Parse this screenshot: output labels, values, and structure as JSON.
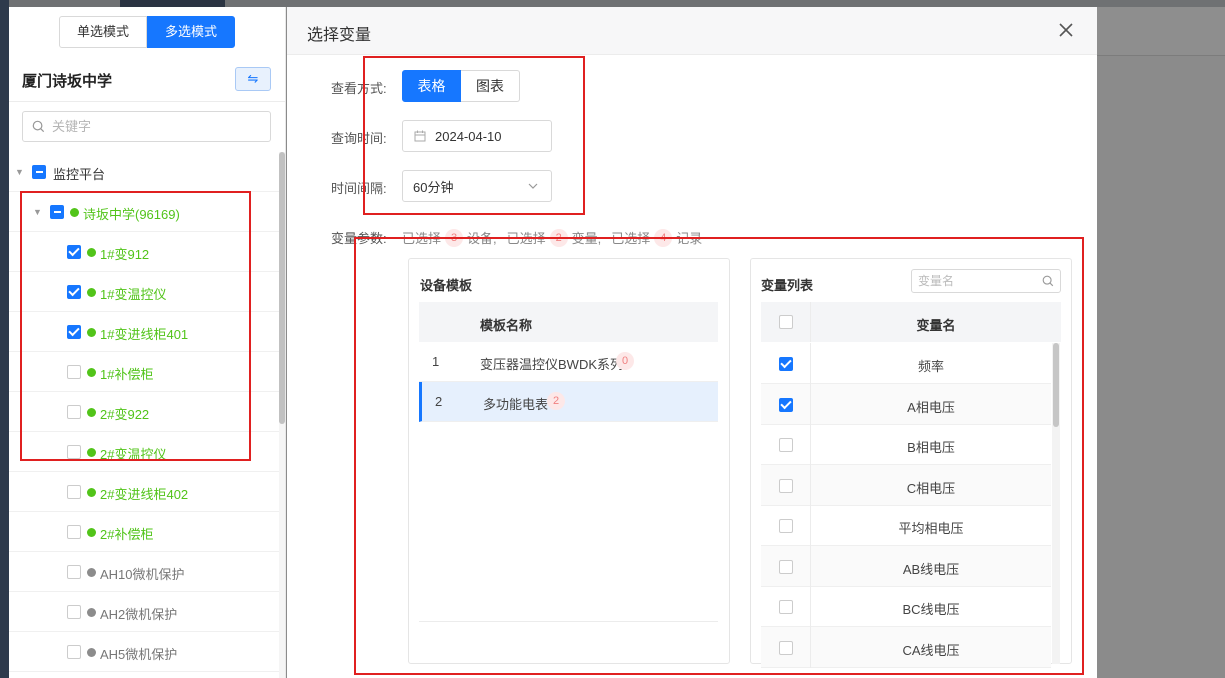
{
  "left_panel": {
    "mode_single": "单选模式",
    "mode_multi": "多选模式",
    "org_title": "厦门诗坂中学",
    "swap_symbol": "⇋",
    "search_placeholder": "关键字",
    "tree": [
      {
        "label": "监控平台",
        "state": "partial",
        "level": 0,
        "dot": "none",
        "color": "dark",
        "expanded": true
      },
      {
        "label": "诗坂中学(96169)",
        "state": "partial",
        "level": 1,
        "dot": "green",
        "color": "green",
        "expanded": true
      },
      {
        "label": "1#变912",
        "state": "checked",
        "level": 2,
        "dot": "green",
        "color": "green"
      },
      {
        "label": "1#变温控仪",
        "state": "checked",
        "level": 2,
        "dot": "green",
        "color": "green"
      },
      {
        "label": "1#变进线柜401",
        "state": "checked",
        "level": 2,
        "dot": "green",
        "color": "green"
      },
      {
        "label": "1#补偿柜",
        "state": "unchecked",
        "level": 2,
        "dot": "green",
        "color": "green"
      },
      {
        "label": "2#变922",
        "state": "unchecked",
        "level": 2,
        "dot": "green",
        "color": "green"
      },
      {
        "label": "2#变温控仪",
        "state": "unchecked",
        "level": 2,
        "dot": "green",
        "color": "green"
      },
      {
        "label": "2#变进线柜402",
        "state": "unchecked",
        "level": 2,
        "dot": "green",
        "color": "green"
      },
      {
        "label": "2#补偿柜",
        "state": "unchecked",
        "level": 2,
        "dot": "green",
        "color": "green"
      },
      {
        "label": "AH10微机保护",
        "state": "unchecked",
        "level": 2,
        "dot": "gray",
        "color": "gray"
      },
      {
        "label": "AH2微机保护",
        "state": "unchecked",
        "level": 2,
        "dot": "gray",
        "color": "gray"
      },
      {
        "label": "AH5微机保护",
        "state": "unchecked",
        "level": 2,
        "dot": "gray",
        "color": "gray"
      }
    ]
  },
  "modal": {
    "title": "选择变量",
    "view_label": "查看方式:",
    "view_table": "表格",
    "view_chart": "图表",
    "time_label": "查询时间:",
    "date_value": "2024-04-10",
    "interval_label": "时间间隔:",
    "interval_value": "60分钟",
    "params_label": "变量参数:",
    "summary": {
      "prefix1": "已选择",
      "count_devices": "3",
      "suffix1": "设备,",
      "prefix2": "已选择",
      "count_vars": "2",
      "suffix2": "变量,",
      "prefix3": "已选择",
      "count_records": "4",
      "suffix3": "记录"
    },
    "template_panel": {
      "title": "设备模板",
      "col_name": "模板名称",
      "rows": [
        {
          "index": "1",
          "name": "变压器温控仪BWDK系列",
          "count": "0",
          "selected": false
        },
        {
          "index": "2",
          "name": "多功能电表",
          "count": "2",
          "selected": true
        }
      ]
    },
    "variable_panel": {
      "title": "变量列表",
      "search_placeholder": "变量名",
      "col_name": "变量名",
      "rows": [
        {
          "name": "频率",
          "checked": true
        },
        {
          "name": "A相电压",
          "checked": true
        },
        {
          "name": "B相电压",
          "checked": false
        },
        {
          "name": "C相电压",
          "checked": false
        },
        {
          "name": "平均相电压",
          "checked": false
        },
        {
          "name": "AB线电压",
          "checked": false
        },
        {
          "name": "BC线电压",
          "checked": false
        },
        {
          "name": "CA线电压",
          "checked": false
        }
      ]
    }
  },
  "colors": {
    "primary": "#1677ff",
    "online": "#52c41a",
    "offline": "#8c8c8c",
    "badge_bg": "#fde8e8",
    "badge_text": "#f08080",
    "annotation": "#e02020"
  }
}
